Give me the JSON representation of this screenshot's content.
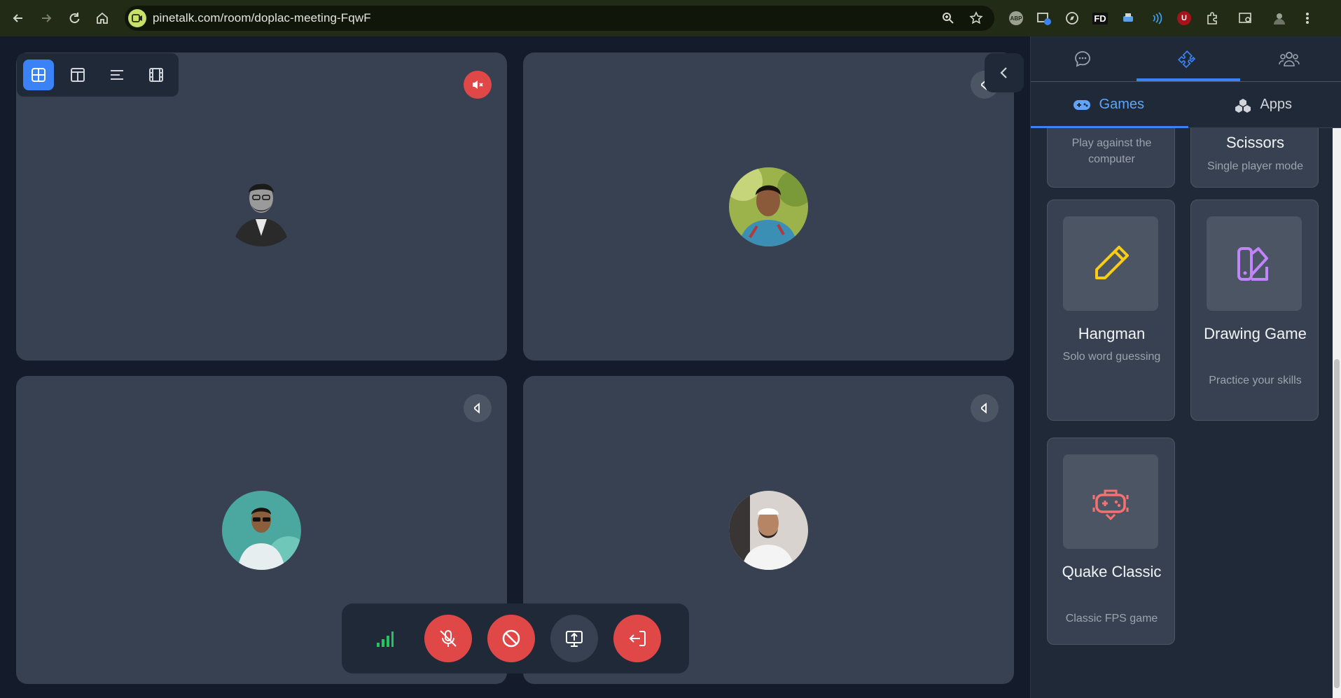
{
  "browser": {
    "url": "pinetalk.com/room/doplac-meeting-FqwF",
    "extensions": [
      "adblock-icon",
      "tab-manager-icon",
      "compass-icon",
      "FD",
      "printer-icon",
      "signal-icon",
      "ublock-icon",
      "puzzle-icon"
    ],
    "ext_fd_label": "FD",
    "ext_abp_label": "ABP",
    "ext_u_label": "U"
  },
  "layout_bar": {
    "buttons": [
      "grid-layout-icon",
      "split-layout-icon",
      "list-layout-icon",
      "filmstrip-layout-icon"
    ],
    "active": "grid-layout-icon"
  },
  "participants": [
    {
      "avatar": "participant-1",
      "audio": "muted"
    },
    {
      "avatar": "participant-2",
      "audio": "on"
    },
    {
      "avatar": "participant-3",
      "audio": "on"
    },
    {
      "avatar": "participant-4",
      "audio": "on"
    }
  ],
  "controls": [
    "signal-strength-icon",
    "mic-off-icon",
    "camera-off-icon",
    "screen-share-icon",
    "leave-icon"
  ],
  "sidebar": {
    "tabs": [
      "chat-icon",
      "puzzle-icon",
      "participants-icon"
    ],
    "active_tab": "puzzle-icon",
    "categories": [
      {
        "label": "Games",
        "icon": "gamepad-icon",
        "active": true
      },
      {
        "label": "Apps",
        "icon": "cubes-icon",
        "active": false
      }
    ],
    "games": [
      {
        "title": "",
        "desc": "Play against the computer"
      },
      {
        "title": "Scissors",
        "desc": "Single player mode"
      },
      {
        "title": "Hangman",
        "desc": "Solo word guessing",
        "icon": "pencil-icon"
      },
      {
        "title": "Drawing Game",
        "desc": "Practice your skills",
        "icon": "swatch-icon"
      },
      {
        "title": "Quake Classic",
        "desc": "Classic FPS game",
        "icon": "game-controller-icon"
      }
    ]
  },
  "colors": {
    "accent": "#3b82f6",
    "danger": "#e04848",
    "tile": "#374151",
    "signal": "#22c55e"
  }
}
